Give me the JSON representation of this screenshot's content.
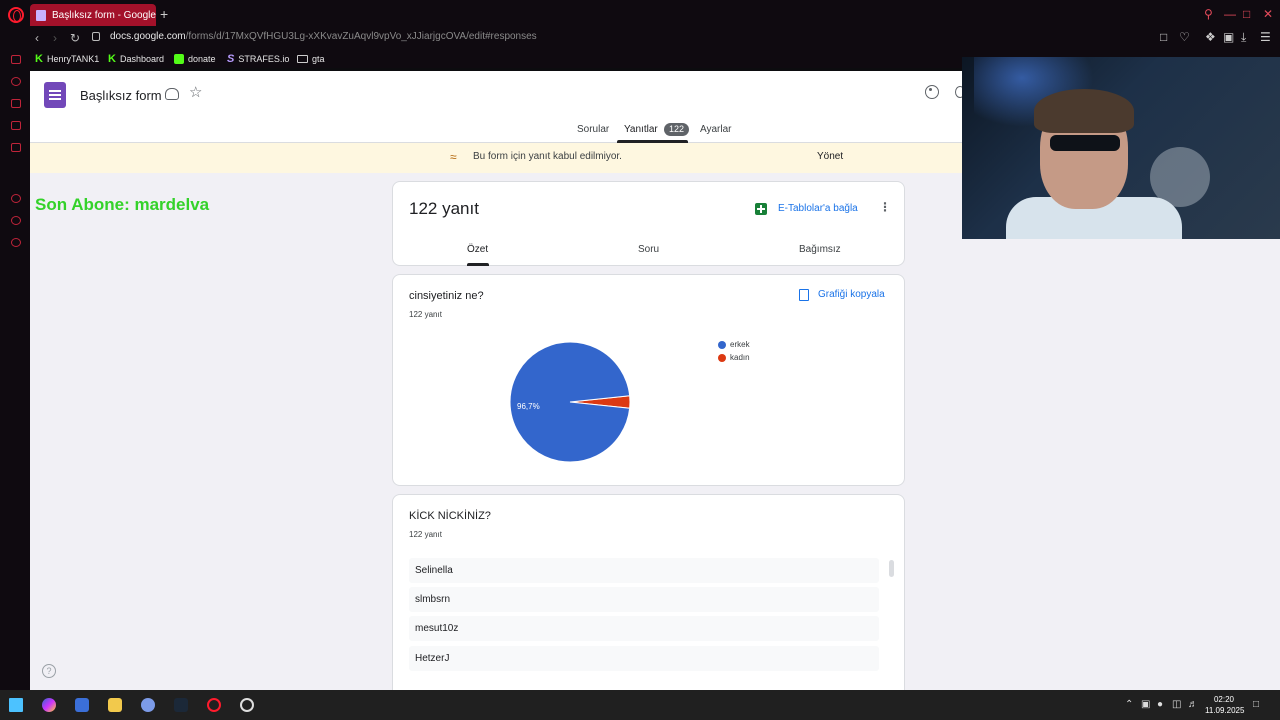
{
  "browser": {
    "tab_title": "Başlıksız form - Google Fo",
    "new_tab": "+",
    "url_domain": "docs.google.com",
    "url_path": "/forms/d/17MxQVfHGU3Lg-xXKvavZuAqvl9vpVo_xJJiarjgcOVA/edit#responses",
    "bookmarks": [
      "HenryTANK1",
      "Dashboard",
      "donate",
      "STRAFES.io",
      "gta"
    ]
  },
  "form": {
    "title": "Başlıksız form",
    "tabs": {
      "questions": "Sorular",
      "responses": "Yanıtlar",
      "settings": "Ayarlar"
    },
    "response_badge": "122",
    "notice": "Bu form için yanıt kabul edilmiyor.",
    "notice_action": "Yönet"
  },
  "overlay": {
    "last_subscriber": "Son Abone: mardelva"
  },
  "summary": {
    "count_title": "122 yanıt",
    "sheets_link": "E-Tablolar'a bağla",
    "subtabs": {
      "summary": "Özet",
      "question": "Soru",
      "individual": "Bağımsız"
    }
  },
  "question1": {
    "title": "cinsiyetiniz ne?",
    "count": "122 yanıt",
    "copy_chart": "Grafiği kopyala"
  },
  "chart_data": {
    "type": "pie",
    "labels": [
      "erkek",
      "kadın"
    ],
    "values": [
      96.7,
      3.3
    ],
    "colors": [
      "#3366cc",
      "#dc3912"
    ],
    "data_labels": [
      "96,7%"
    ],
    "legend_position": "right"
  },
  "question2": {
    "title": "KİCK NİCKİNİZ?",
    "count": "122 yanıt",
    "responses": [
      "Selinella",
      "slmbsrn",
      "mesut10z",
      "HetzerJ"
    ]
  },
  "taskbar": {
    "time": "02:20",
    "date": "11.09.2025"
  }
}
